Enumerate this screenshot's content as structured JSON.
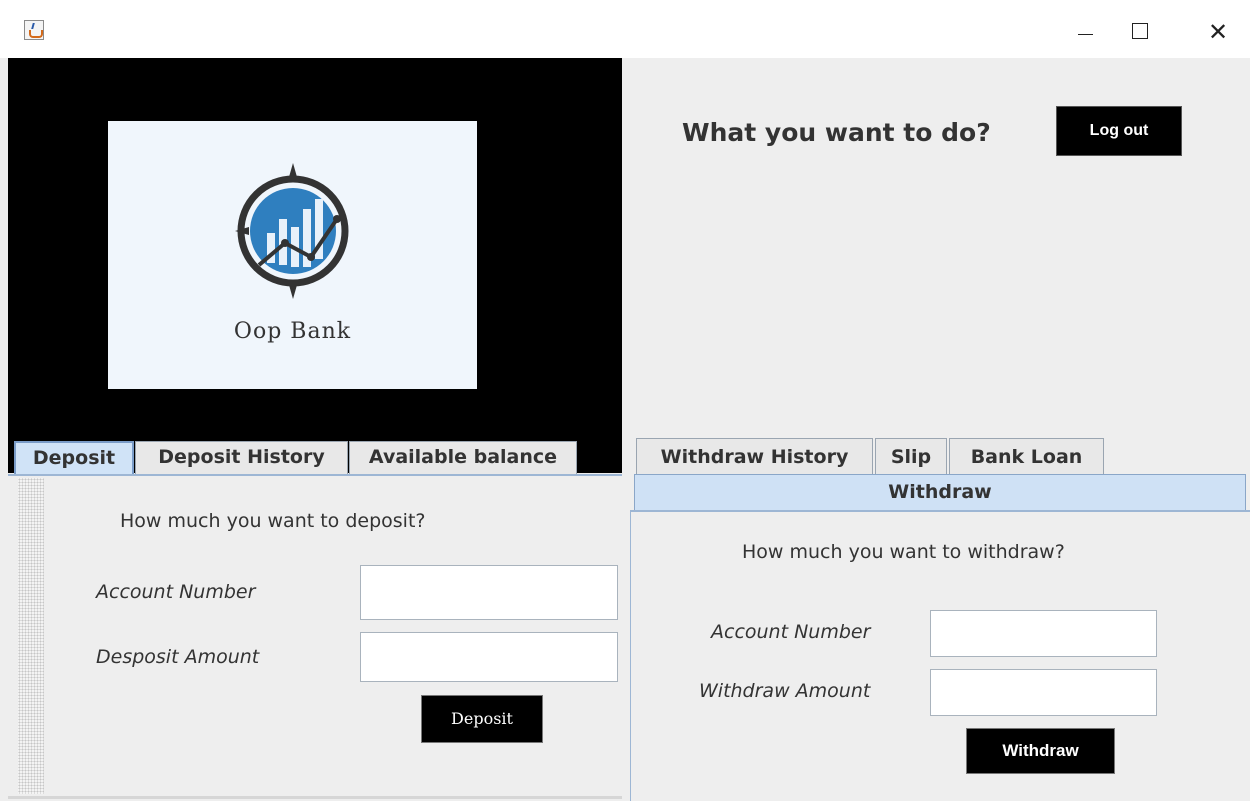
{
  "window": {
    "minimize": "—",
    "maximize": "☐",
    "close": "✕"
  },
  "logo": {
    "text": "Oop Bank",
    "icon": "compass-chart-logo"
  },
  "header": {
    "question": "What you want to do?",
    "logout_label": "Log out"
  },
  "left_tabs": [
    {
      "label": "Deposit",
      "active": true
    },
    {
      "label": "Deposit History",
      "active": false
    },
    {
      "label": "Available balance",
      "active": false
    }
  ],
  "deposit": {
    "question": "How much you want to deposit?",
    "account_label": "Account Number",
    "amount_label": "Desposit Amount",
    "account_value": "",
    "amount_value": "",
    "button_label": "Deposit"
  },
  "right_tabs": [
    {
      "label": "Withdraw History",
      "active": false
    },
    {
      "label": "Slip",
      "active": false
    },
    {
      "label": "Bank Loan",
      "active": false
    },
    {
      "label": "Withdraw",
      "active": true
    }
  ],
  "withdraw": {
    "question": "How much you want to withdraw?",
    "account_label": "Account Number",
    "amount_label": "Withdraw Amount",
    "account_value": "",
    "amount_value": "",
    "button_label": "Withdraw"
  },
  "colors": {
    "accent_tab": "#cfe1f5",
    "logo_blue": "#2f7fbf",
    "button_bg": "#000000"
  }
}
